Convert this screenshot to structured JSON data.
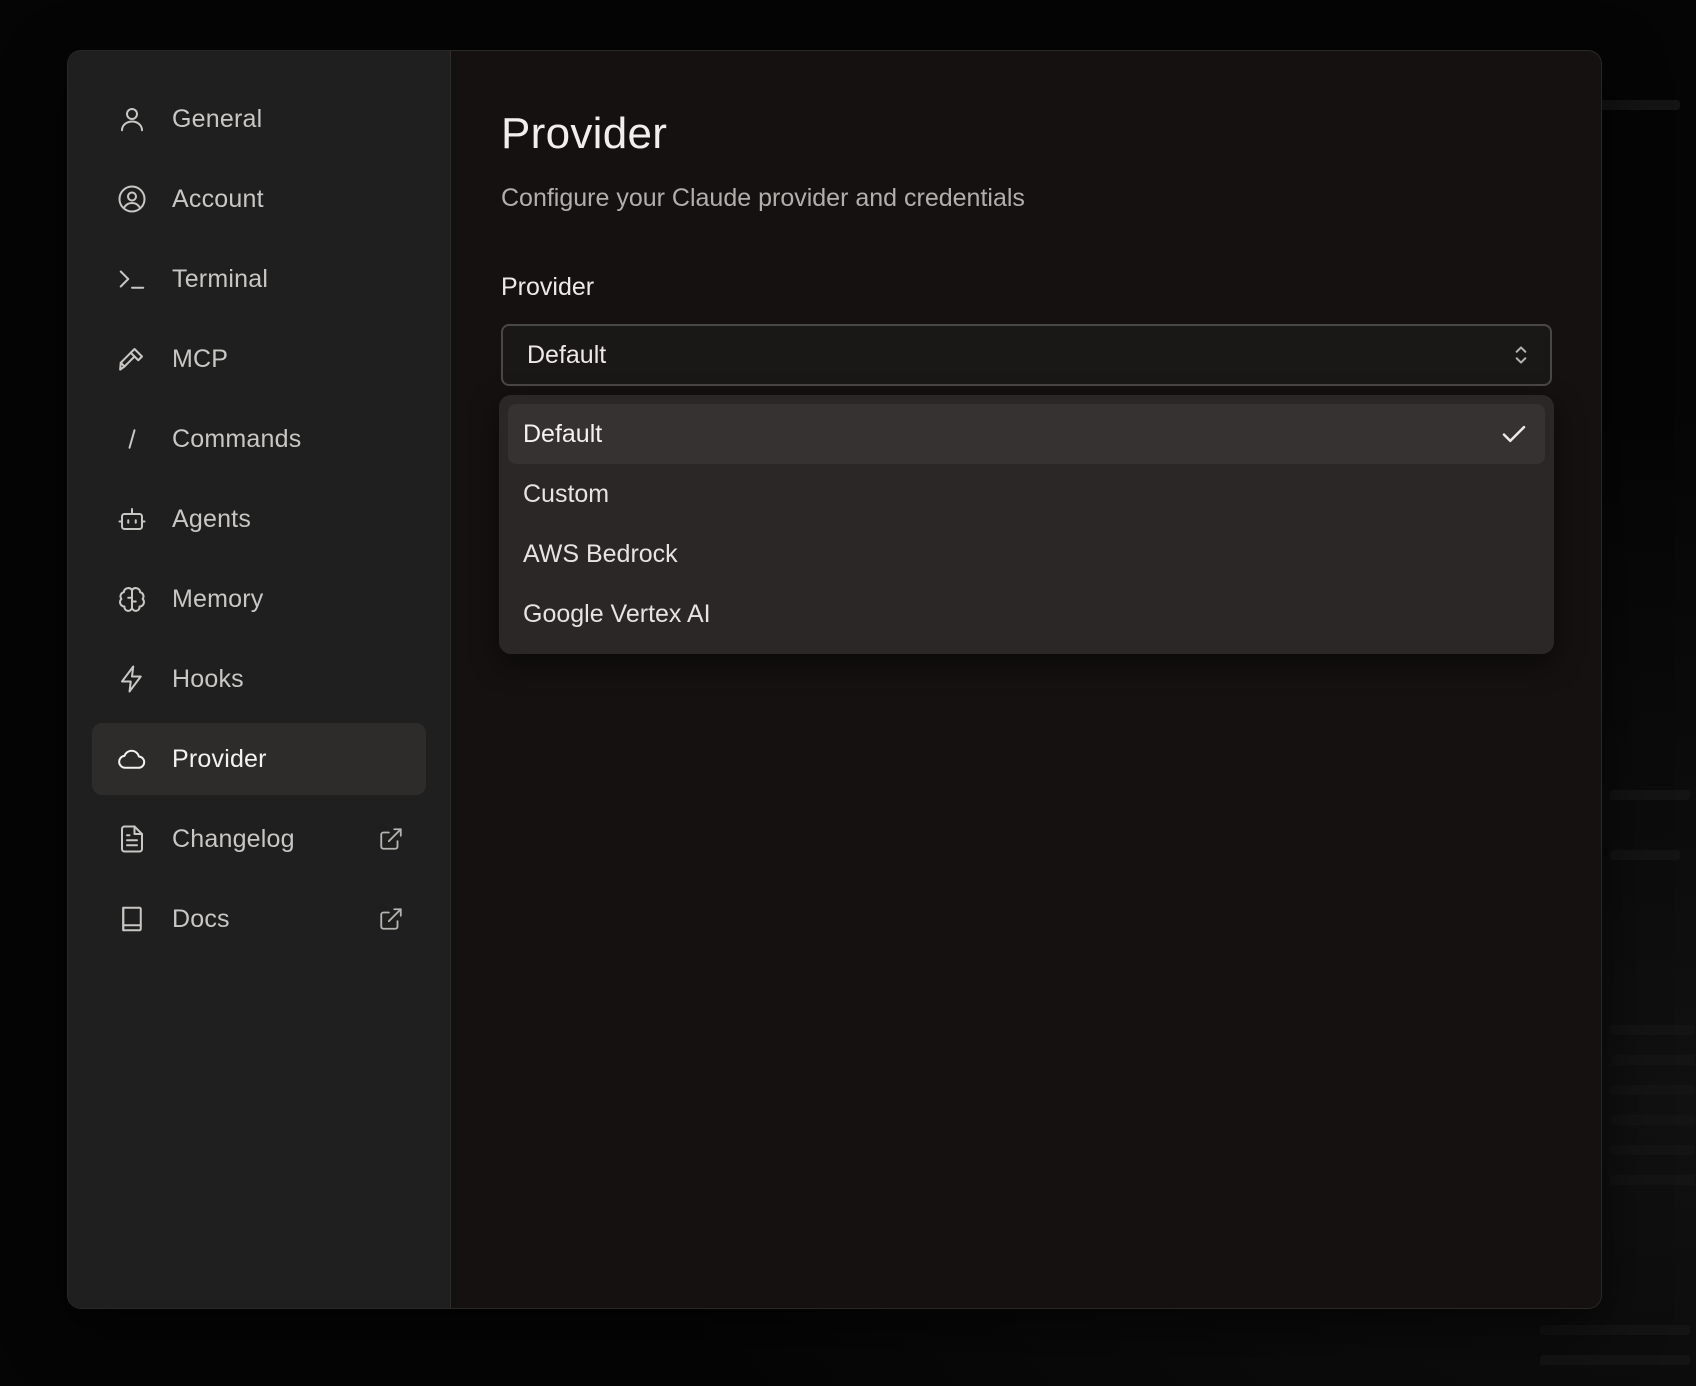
{
  "sidebar": {
    "items": [
      {
        "label": "General",
        "icon": "user-icon",
        "active": false,
        "external": false
      },
      {
        "label": "Account",
        "icon": "user-circle-icon",
        "active": false,
        "external": false
      },
      {
        "label": "Terminal",
        "icon": "terminal-icon",
        "active": false,
        "external": false
      },
      {
        "label": "MCP",
        "icon": "hammer-icon",
        "active": false,
        "external": false
      },
      {
        "label": "Commands",
        "icon": "slash-icon",
        "active": false,
        "external": false
      },
      {
        "label": "Agents",
        "icon": "robot-icon",
        "active": false,
        "external": false
      },
      {
        "label": "Memory",
        "icon": "brain-icon",
        "active": false,
        "external": false
      },
      {
        "label": "Hooks",
        "icon": "lightning-icon",
        "active": false,
        "external": false
      },
      {
        "label": "Provider",
        "icon": "cloud-icon",
        "active": true,
        "external": false
      },
      {
        "label": "Changelog",
        "icon": "document-icon",
        "active": false,
        "external": true
      },
      {
        "label": "Docs",
        "icon": "book-icon",
        "active": false,
        "external": true
      }
    ]
  },
  "main": {
    "title": "Provider",
    "subtitle": "Configure your Claude provider and credentials",
    "provider_field": {
      "label": "Provider",
      "value": "Default",
      "options": [
        {
          "label": "Default",
          "selected": true
        },
        {
          "label": "Custom",
          "selected": false
        },
        {
          "label": "AWS Bedrock",
          "selected": false
        },
        {
          "label": "Google Vertex AI",
          "selected": false
        }
      ]
    }
  },
  "colors": {
    "background": "#050505",
    "dialog": "#141110",
    "sidebar": "#1f1f1f",
    "active_item": "#2d2c2b",
    "dropdown": "#2a2726",
    "dropdown_selected": "#363231"
  }
}
